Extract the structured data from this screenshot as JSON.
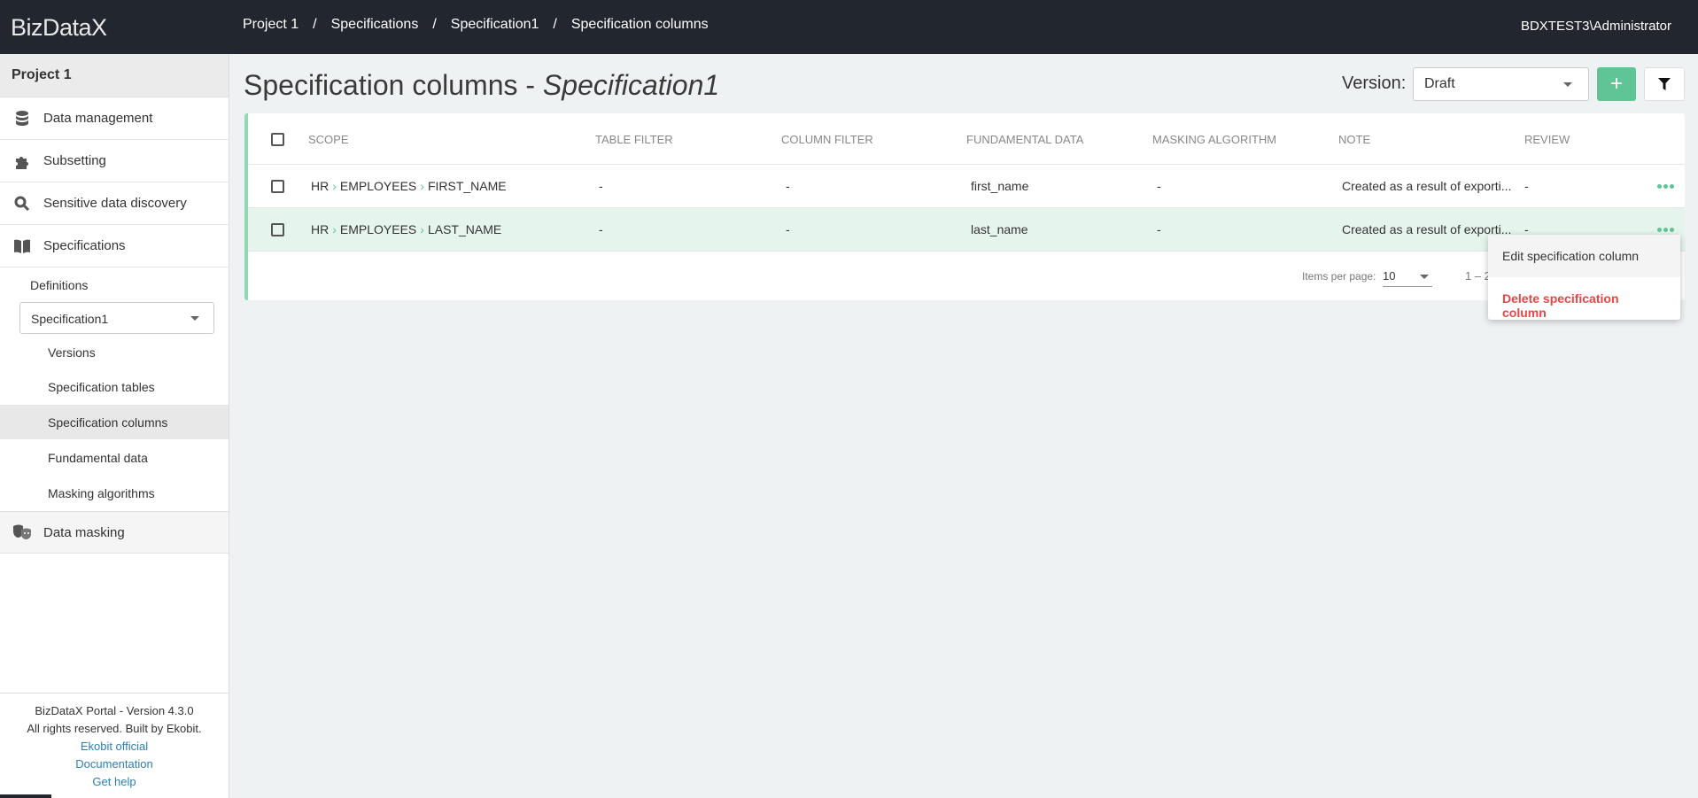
{
  "header": {
    "logo": "BizDataX",
    "breadcrumbs": [
      "Project 1",
      "Specifications",
      "Specification1",
      "Specification columns"
    ],
    "user": "BDXTEST3\\Administrator"
  },
  "sidebar": {
    "project": "Project 1",
    "items": [
      {
        "label": "Data management",
        "icon": "database-icon"
      },
      {
        "label": "Subsetting",
        "icon": "puzzle-icon"
      },
      {
        "label": "Sensitive data discovery",
        "icon": "search-icon"
      },
      {
        "label": "Specifications",
        "icon": "book-icon"
      }
    ],
    "definitions": "Definitions",
    "spec_select": "Specification1",
    "sub_items": [
      "Versions",
      "Specification tables",
      "Specification columns",
      "Fundamental data",
      "Masking algorithms"
    ],
    "active_sub": "Specification columns",
    "data_masking": "Data masking",
    "footer": {
      "version": "BizDataX Portal - Version 4.3.0",
      "rights": "All rights reserved. Built by Ekobit.",
      "links": [
        "Ekobit official",
        "Documentation",
        "Get help"
      ]
    }
  },
  "main": {
    "title": "Specification columns - ",
    "title_italic": "Specification1",
    "version_label": "Version:",
    "version_value": "Draft",
    "add_label": "+",
    "columns": [
      "Scope",
      "Table filter",
      "Column filter",
      "Fundamental data",
      "Masking algorithm",
      "Note",
      "Review"
    ],
    "rows": [
      {
        "scope": [
          "HR",
          "EMPLOYEES",
          "FIRST_NAME"
        ],
        "table_filter": "-",
        "column_filter": "-",
        "fundamental": "first_name",
        "masking": "-",
        "note": "Created as a result of exporti...",
        "review": "-"
      },
      {
        "scope": [
          "HR",
          "EMPLOYEES",
          "LAST_NAME"
        ],
        "table_filter": "-",
        "column_filter": "-",
        "fundamental": "last_name",
        "masking": "-",
        "note": "Created as a result of exporti...",
        "review": "-"
      }
    ],
    "paginator": {
      "label": "Items per page:",
      "size": "10",
      "range": "1 – 2"
    },
    "menu": {
      "edit": "Edit specification column",
      "delete": "Delete specification column"
    }
  },
  "colors": {
    "accent": "#5fc596",
    "header": "#22262e",
    "danger": "#e84545",
    "row_highlight": "#e6f4ee"
  }
}
